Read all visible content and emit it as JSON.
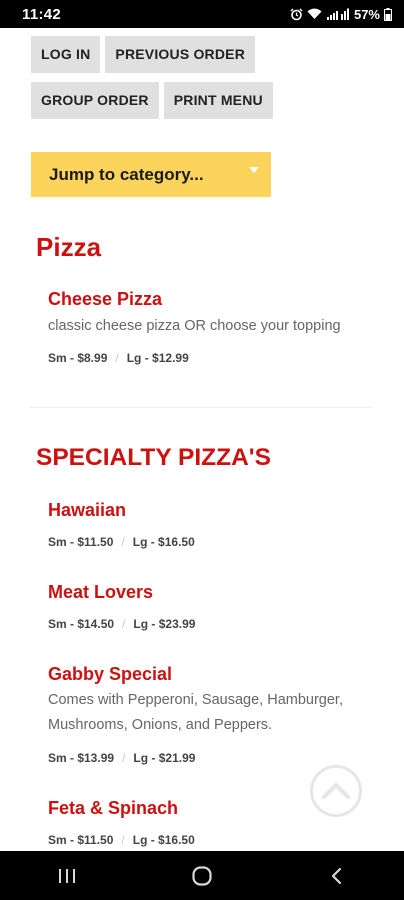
{
  "status_bar": {
    "time": "11:42",
    "battery": "57%"
  },
  "buttons": {
    "log_in": "LOG IN",
    "previous_order": "PREVIOUS ORDER",
    "group_order": "GROUP ORDER",
    "print_menu": "PRINT MENU"
  },
  "jump_to_category": {
    "label": "Jump to category..."
  },
  "sections": [
    {
      "title": "Pizza",
      "items": [
        {
          "name": "Cheese Pizza",
          "description": "classic cheese pizza OR choose your topping",
          "prices": [
            "Sm - $8.99",
            "Lg - $12.99"
          ]
        }
      ]
    },
    {
      "title": "SPECIALTY PIZZA'S",
      "items": [
        {
          "name": "Hawaiian",
          "prices": [
            "Sm - $11.50",
            "Lg - $16.50"
          ]
        },
        {
          "name": "Meat Lovers",
          "prices": [
            "Sm - $14.50",
            "Lg - $23.99"
          ]
        },
        {
          "name": "Gabby Special",
          "description": "Comes with Pepperoni, Sausage, Hamburger, Mushrooms, Onions, and Peppers.",
          "prices": [
            "Sm - $13.99",
            "Lg - $21.99"
          ]
        },
        {
          "name": "Feta & Spinach",
          "prices": [
            "Sm - $11.50",
            "Lg - $16.50"
          ]
        }
      ]
    }
  ],
  "icons": {
    "scroll_top": "chevron-up-circle-icon",
    "nav_recent": "recent-apps-icon",
    "nav_home": "home-icon",
    "nav_back": "back-icon"
  },
  "colors": {
    "accent_red": "#cc1111",
    "jump_yellow": "#fcd45c",
    "button_gray": "#e0e0e0"
  }
}
